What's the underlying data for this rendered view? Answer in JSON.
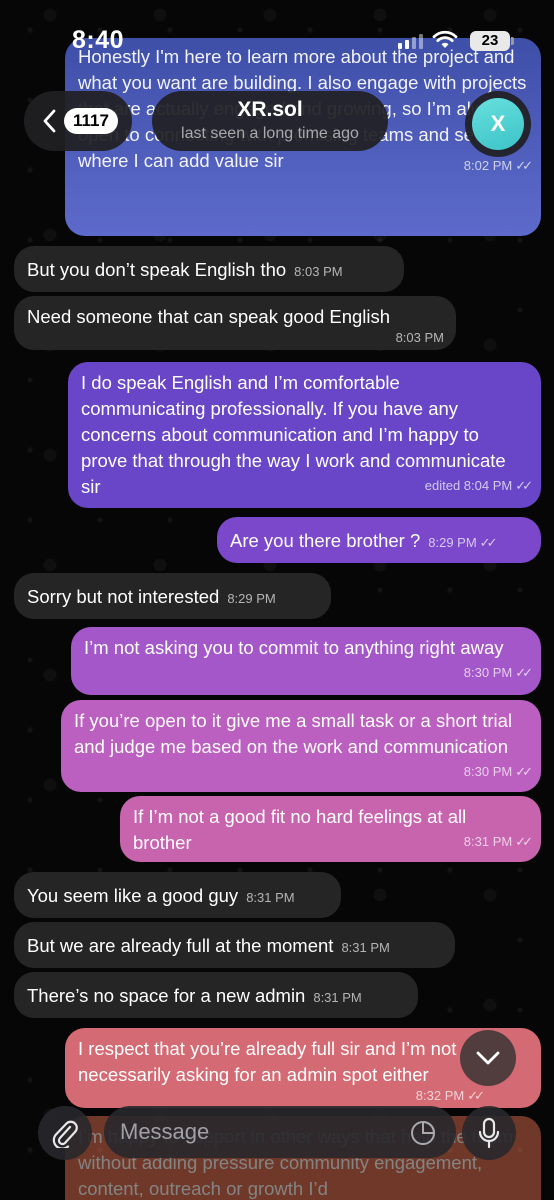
{
  "status_bar": {
    "time": "8:40",
    "battery": "23"
  },
  "header": {
    "back_count": "1117",
    "title": "XR.sol",
    "subtitle": "last seen a long time ago",
    "avatar_initial": "X",
    "avatar_color": "#4fd1d3"
  },
  "messages": [
    {
      "dir": "out",
      "text": "Honestly I'm here to learn more about the project and what you want are building. I also engage with projects that are actually engaged and growing, so I’m always open to connecting with promising teams and seeing where I can add value sir",
      "time": "8:02 PM",
      "read": true
    },
    {
      "dir": "in",
      "text": "But you don’t speak English tho",
      "time": "8:03 PM"
    },
    {
      "dir": "in",
      "text": "Need someone that can speak good English",
      "time": "8:03 PM"
    },
    {
      "dir": "out",
      "text": "I do speak English and I’m comfortable communicating professionally. If you have any concerns about communication and I’m happy to prove that through the way I work and communicate sir",
      "time": "edited 8:04 PM",
      "read": true
    },
    {
      "dir": "out",
      "text": "Are you there brother ?",
      "time": "8:29 PM",
      "read": true
    },
    {
      "dir": "in",
      "text": "Sorry but not interested",
      "time": "8:29 PM"
    },
    {
      "dir": "out",
      "text": "I’m not asking you to commit to anything right away",
      "time": "8:30 PM",
      "read": true
    },
    {
      "dir": "out",
      "text": "If you’re open to it give me a small task or a short trial and judge me based on the work and communication",
      "time": "8:30 PM",
      "read": true
    },
    {
      "dir": "out",
      "text": "If I’m not a good fit no hard feelings at all brother",
      "time": "8:31 PM",
      "read": true
    },
    {
      "dir": "in",
      "text": "You seem like a good guy",
      "time": "8:31 PM"
    },
    {
      "dir": "in",
      "text": "But we are already full at the moment",
      "time": "8:31 PM"
    },
    {
      "dir": "in",
      "text": "There’s no space for a new admin",
      "time": "8:31 PM"
    },
    {
      "dir": "out",
      "text": "I respect that you’re already full sir and I’m not necessarily asking for an admin spot either",
      "time": "8:32 PM",
      "read": true
    },
    {
      "dir": "out",
      "text": "I’m happy to support in other ways that help the team without adding pressure community engagement, content, outreach or growth I’d",
      "time": "",
      "read": false
    }
  ],
  "colors": {
    "bubble_in": "#262628",
    "bubble_out_1": "#5b6bc9",
    "bubble_out_2": "#6a4fd0",
    "bubble_out_3": "#8a4fd0",
    "bubble_out_4": "#b65fc4",
    "bubble_out_5": "#c967b2",
    "bubble_out_6": "#d56a7c"
  },
  "input": {
    "placeholder": "Message"
  },
  "icons": {
    "back": "chevron-left-icon",
    "attach": "paperclip-icon",
    "sticker": "sticker-icon",
    "mic": "microphone-icon",
    "scroll": "chevron-down-icon"
  }
}
